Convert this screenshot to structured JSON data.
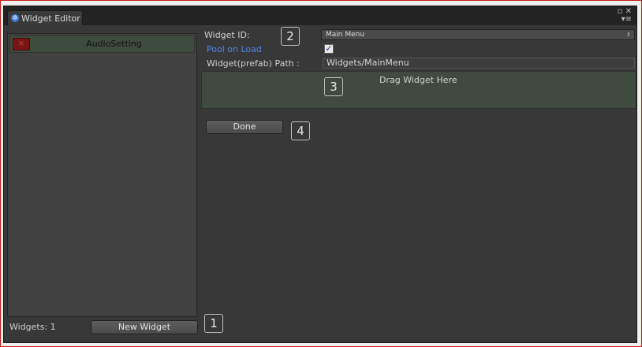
{
  "window": {
    "tab_title": "Widget Editor",
    "tab_icon": "gear-icon",
    "controls": {
      "maximize": "▫",
      "close": "✕",
      "menu": "▾≡"
    }
  },
  "left_panel": {
    "items": [
      {
        "label": "AudioSetting",
        "delete_icon": "x-icon",
        "delete_glyph": "×"
      }
    ],
    "count_text": "Widgets: 1",
    "new_button_label": "New Widget"
  },
  "form": {
    "widget_id_label": "Widget ID:",
    "widget_id_value": "Main Menu",
    "pool_label": "Pool on Load",
    "pool_checked": true,
    "check_glyph": "✓",
    "path_label": "Widget(prefab) Path :",
    "path_value": "Widgets/MainMenu",
    "drop_text": "Drag Widget Here",
    "done_label": "Done",
    "select_arrows": "⇕"
  },
  "callouts": [
    "1",
    "2",
    "3",
    "4"
  ],
  "colors": {
    "accent_blue": "#4f86e8",
    "item_bg": "#3e4c3e",
    "delete_red": "#7a1515",
    "frame_red": "#c41a1a"
  }
}
